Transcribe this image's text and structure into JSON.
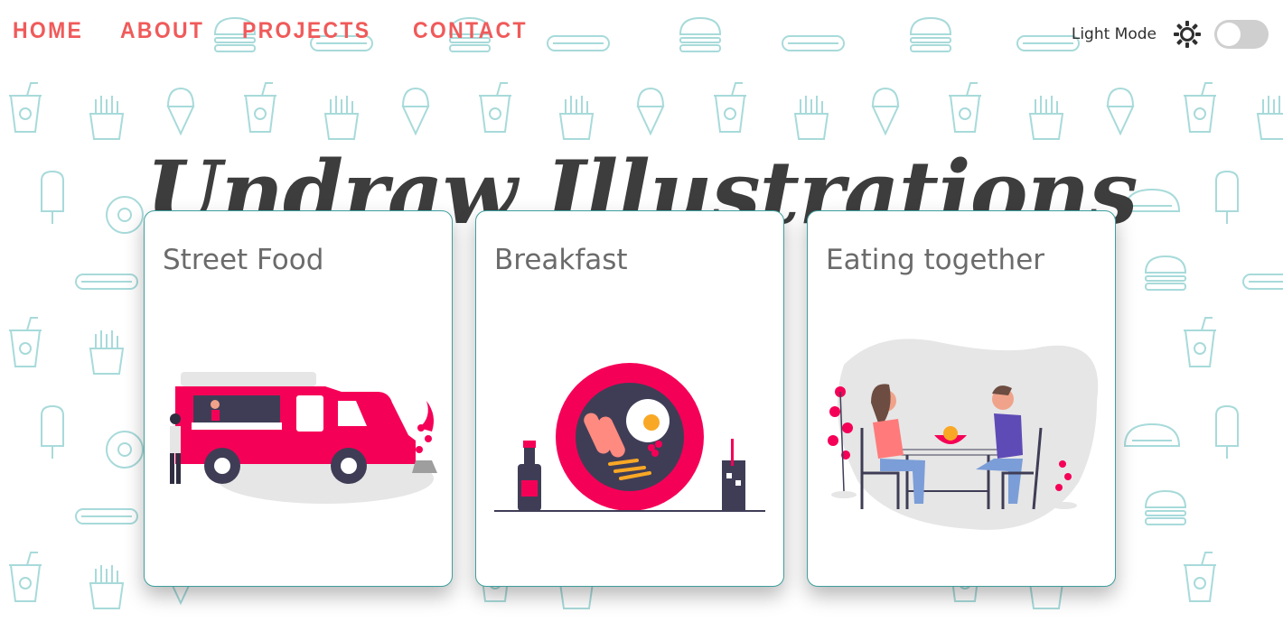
{
  "nav": {
    "items": [
      {
        "label": "HOME"
      },
      {
        "label": "ABOUT"
      },
      {
        "label": "PROJECTS"
      },
      {
        "label": "CONTACT"
      }
    ]
  },
  "theme": {
    "label": "Light Mode",
    "icon": "sun-icon",
    "toggle_on": false,
    "accent": "#f05a5a",
    "card_border": "#3f9e9e",
    "pattern_color": "#a8dada",
    "illustration_accent": "#f50057"
  },
  "title": "Undraw Illustrations",
  "cards": [
    {
      "title": "Street Food",
      "illustration": "food-truck-illustration"
    },
    {
      "title": "Breakfast",
      "illustration": "breakfast-plate-illustration"
    },
    {
      "title": "Eating together",
      "illustration": "couple-dining-illustration"
    }
  ]
}
